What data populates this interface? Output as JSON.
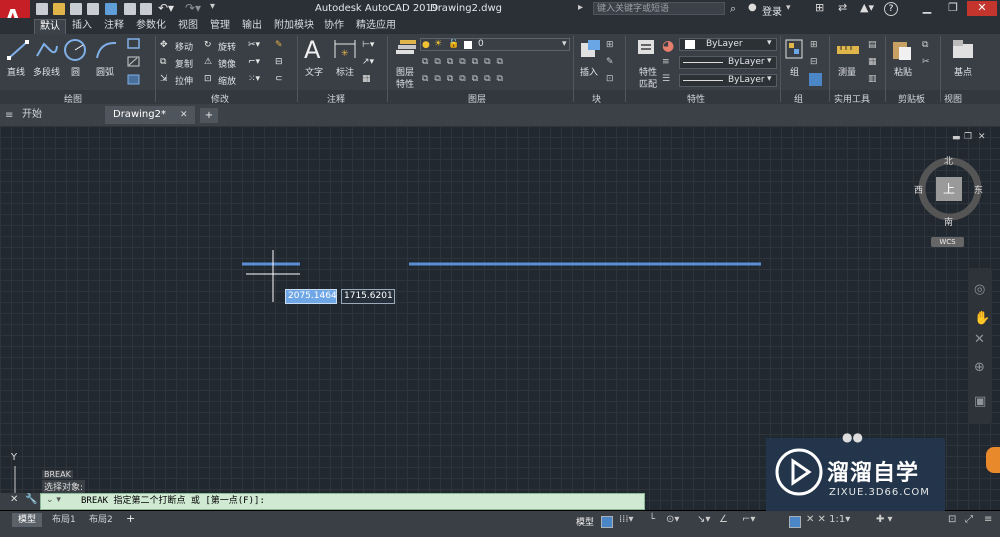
{
  "title_bar": {
    "app_title": "Autodesk AutoCAD 2019",
    "document": "Drawing2.dwg",
    "search_placeholder": "键入关键字或短语",
    "login_label": "登录",
    "help_label": "?"
  },
  "ribbon_tabs": [
    "默认",
    "插入",
    "注释",
    "参数化",
    "视图",
    "管理",
    "输出",
    "附加模块",
    "协作",
    "精选应用"
  ],
  "ribbon": {
    "draw": {
      "line": "直线",
      "polyline": "多段线",
      "circle": "圆",
      "arc": "圆弧",
      "panel": "绘图"
    },
    "modify": {
      "move": "移动",
      "rotate": "旋转",
      "copy": "复制",
      "mirror": "镜像",
      "stretch": "拉伸",
      "scale": "缩放",
      "panel": "修改"
    },
    "annotation": {
      "text": "文字",
      "dimension": "标注",
      "panel": "注释"
    },
    "layers": {
      "layer_properties": "图层\n特性",
      "layer_properties_line1": "图层",
      "layer_properties_line2": "特性",
      "current_layer": "0",
      "panel": "图层"
    },
    "block": {
      "insert": "插入",
      "panel": "块"
    },
    "properties": {
      "match_line1": "特性",
      "match_line2": "匹配",
      "color": "ByLayer",
      "linetype": "ByLayer",
      "lineweight": "ByLayer",
      "panel": "特性"
    },
    "groups": {
      "group": "组",
      "panel": "组"
    },
    "utilities": {
      "measure": "测量",
      "panel": "实用工具"
    },
    "clipboard": {
      "paste": "粘贴",
      "panel": "剪贴板"
    },
    "view": {
      "base": "基点",
      "panel": "视图"
    }
  },
  "document_tabs": {
    "start": "开始",
    "drawing": "Drawing2*"
  },
  "viewcube": {
    "north": "北",
    "south": "南",
    "east": "东",
    "west": "西",
    "top": "上",
    "wcs": "WCS"
  },
  "input": {
    "x": "2075.1464",
    "y": "1715.6201"
  },
  "ucs": {
    "y_label": "Y"
  },
  "command": {
    "history1": "BREAK",
    "history2": "选择对象:",
    "prompt": "BREAK 指定第二个打断点 或 [第一点(F)]:"
  },
  "layout_tabs": [
    "模型",
    "布局1",
    "布局2"
  ],
  "status": {
    "model": "模型"
  },
  "watermark": {
    "brand": "溜溜自学",
    "url": "ZIXUE.3D66.COM"
  },
  "colors": {
    "line_blue": "#5a8fd6",
    "ribbon_bg": "#3a3f45",
    "canvas_bg": "#212830",
    "cmd_bg": "#cfe9d3",
    "watermark_bg": "#24364d"
  }
}
